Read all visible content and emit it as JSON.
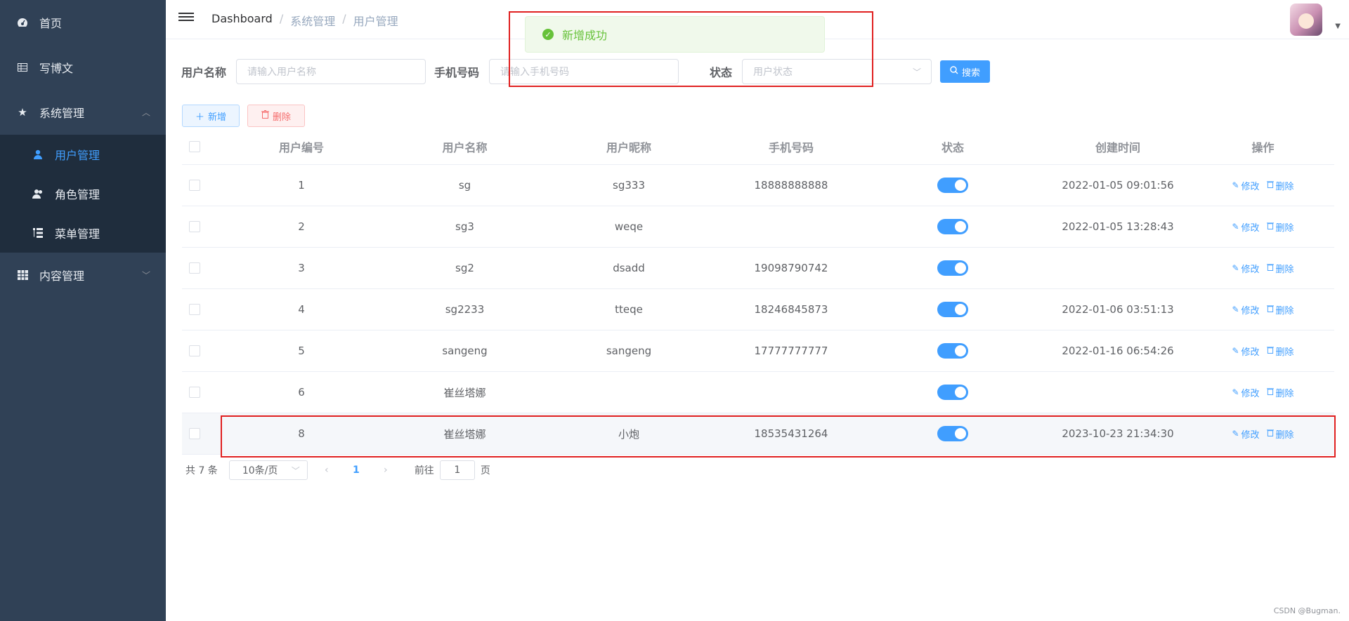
{
  "sidebar": {
    "items": [
      {
        "label": "首页",
        "icon": "dashboard-icon"
      },
      {
        "label": "写博文",
        "icon": "edit-icon"
      },
      {
        "label": "系统管理",
        "icon": "star-icon"
      },
      {
        "label": "用户管理",
        "icon": "user-icon"
      },
      {
        "label": "角色管理",
        "icon": "peoples-icon"
      },
      {
        "label": "菜单管理",
        "icon": "tree-table-icon"
      },
      {
        "label": "内容管理",
        "icon": "table-icon"
      }
    ]
  },
  "header": {
    "breadcrumb": [
      "Dashboard",
      "系统管理",
      "用户管理"
    ]
  },
  "toast": {
    "message": "新增成功"
  },
  "search": {
    "username_label": "用户名称",
    "username_placeholder": "请输入用户名称",
    "phone_label": "手机号码",
    "phone_placeholder": "请输入手机号码",
    "status_label": "状态",
    "status_placeholder": "用户状态",
    "search_button": "搜索"
  },
  "actions": {
    "add": "新增",
    "delete": "删除"
  },
  "table": {
    "columns": [
      "用户编号",
      "用户名称",
      "用户昵称",
      "手机号码",
      "状态",
      "创建时间",
      "操作"
    ],
    "rows": [
      {
        "id": "1",
        "name": "sg",
        "nick": "sg333",
        "phone": "18888888888",
        "time": "2022-01-05 09:01:56"
      },
      {
        "id": "2",
        "name": "sg3",
        "nick": "weqe",
        "phone": "",
        "time": "2022-01-05 13:28:43"
      },
      {
        "id": "3",
        "name": "sg2",
        "nick": "dsadd",
        "phone": "19098790742",
        "time": ""
      },
      {
        "id": "4",
        "name": "sg2233",
        "nick": "tteqe",
        "phone": "18246845873",
        "time": "2022-01-06 03:51:13"
      },
      {
        "id": "5",
        "name": "sangeng",
        "nick": "sangeng",
        "phone": "17777777777",
        "time": "2022-01-16 06:54:26"
      },
      {
        "id": "6",
        "name": "崔丝塔娜",
        "nick": "",
        "phone": "",
        "time": ""
      },
      {
        "id": "8",
        "name": "崔丝塔娜",
        "nick": "小炮",
        "phone": "18535431264",
        "time": "2023-10-23 21:34:30"
      }
    ],
    "edit_label": "修改",
    "delete_label": "删除"
  },
  "pagination": {
    "total": "共 7 条",
    "page_size": "10条/页",
    "current": "1",
    "goto_label": "前往",
    "goto_value": "1",
    "page_suffix": "页"
  },
  "watermark": "CSDN @Bugman."
}
